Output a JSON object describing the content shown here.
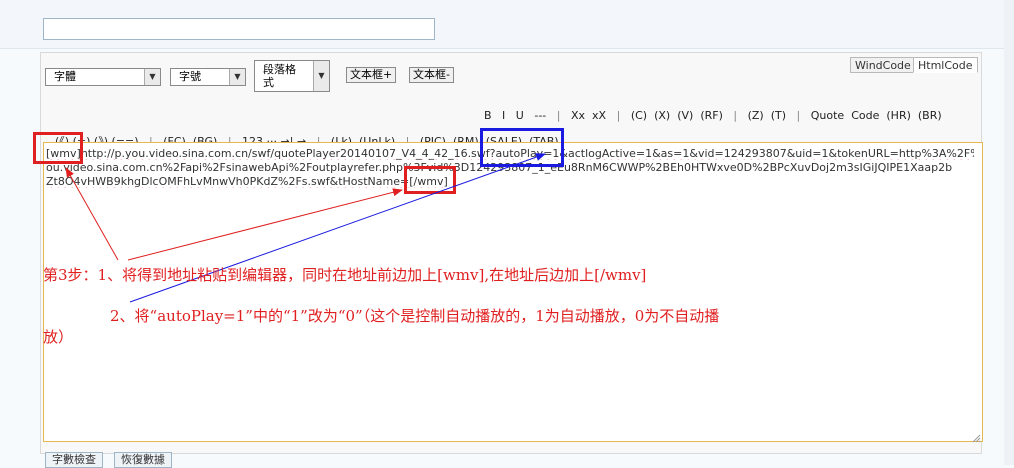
{
  "editor": {
    "mode_tabs": [
      "WindCode",
      "HtmlCode"
    ],
    "font_select": "字體",
    "size_select": "字號",
    "para_select": [
      "段落格",
      "式"
    ],
    "textbox_plus": "文本框+",
    "textbox_minus": "文本框-",
    "row1": [
      "B",
      "I",
      "U",
      "---",
      "|",
      "Xx",
      "xX",
      "|",
      "(C)",
      "(X)",
      "(V)",
      "(RF)",
      "|",
      "(Z)",
      "(T)",
      "|",
      "Quote",
      "Code",
      "(HR)",
      "(BR)"
    ],
    "row2": [
      "(《)",
      "(=)",
      "(》)",
      "(==)",
      "|",
      "(FC)",
      "(BG)",
      "|",
      "123",
      "···",
      "→|",
      "→",
      "|",
      "(Lk)",
      "(UnLk)",
      "|",
      "(PIC)",
      "(RM)",
      "(SALE)",
      "(TAB)"
    ],
    "content": {
      "tag_open": "[wmv]",
      "line1_rest": "http://p.you.video.sina.com.cn/swf/quotePlayer20140107_V4_4_42_16.swf?autoPlay=1&actlogActive=1&as=1&vid=124293807&uid=1&tokenURL=http%3A%2F%2Fy",
      "line2": "ou.video.sina.com.cn%2Fapi%2FsinawebApi%2Foutplayrefer.php%3Fvid%3D124293807_1_eEu8RnM6CWWP%2BEh0HTWxve0D%2BPcXuvDoj2m3sIGiJQIPE1Xaap2b",
      "line3_before": "Zt8O4vHWB9khgDlcOMFhLvMnwVh0PKdZ%2Fs.swf&tHostName=",
      "tag_close": "[/wmv]"
    }
  },
  "annotations": {
    "step3_line1": "第3步：1、将得到地址粘贴到编辑器，同时在地址前边加上[wmv],在地址后边加上[/wmv]",
    "step3_line2": "2、将“autoPlay=1”中的“1”改为“0”（这个是控制自动播放的，1为自动播放，0为不自动播",
    "step3_line3": "放）"
  },
  "bottom_buttons": [
    "字數檢查",
    "恢復數據"
  ],
  "colors": {
    "red": "#e02020",
    "blue": "#1a1ae0"
  }
}
